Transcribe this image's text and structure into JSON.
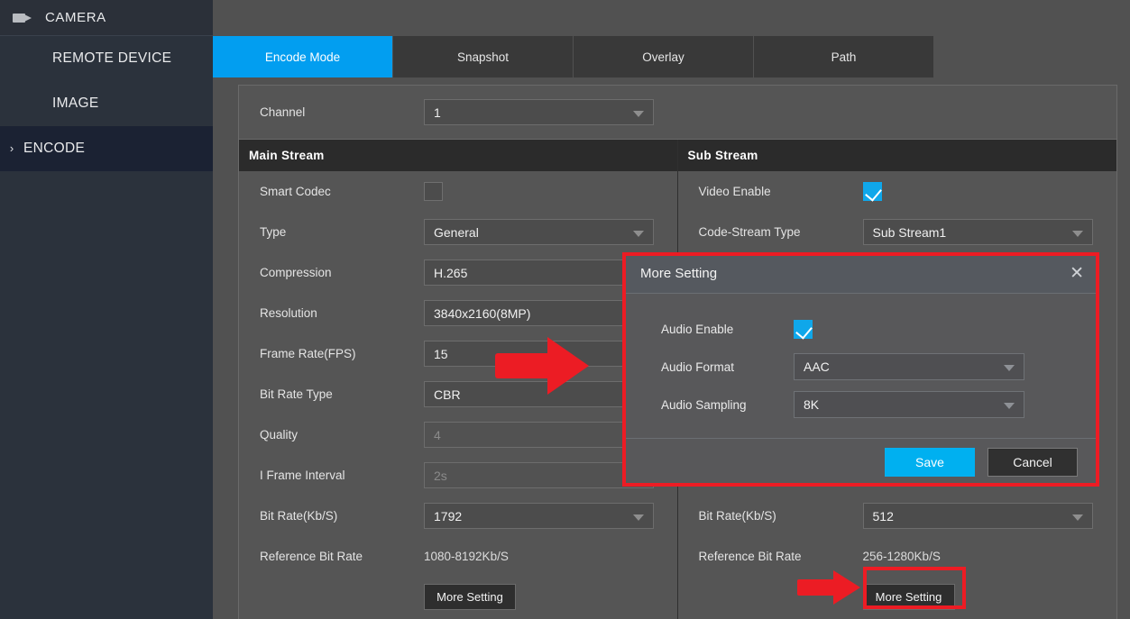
{
  "sidebar": {
    "header": {
      "title": "CAMERA",
      "icon": "video-camera-icon"
    },
    "items": [
      {
        "label": "REMOTE DEVICE",
        "active": false,
        "chevron": ""
      },
      {
        "label": "IMAGE",
        "active": false,
        "chevron": ""
      },
      {
        "label": "ENCODE",
        "active": true,
        "chevron": "›"
      }
    ]
  },
  "tabs": [
    {
      "label": "Encode Mode",
      "active": true
    },
    {
      "label": "Snapshot",
      "active": false
    },
    {
      "label": "Overlay",
      "active": false
    },
    {
      "label": "Path",
      "active": false
    }
  ],
  "channel": {
    "label": "Channel",
    "value": "1"
  },
  "main_stream": {
    "header": "Main Stream",
    "smart_codec_label": "Smart Codec",
    "smart_codec_checked": false,
    "type_label": "Type",
    "type_value": "General",
    "compression_label": "Compression",
    "compression_value": "H.265",
    "resolution_label": "Resolution",
    "resolution_value": "3840x2160(8MP)",
    "frame_rate_label": "Frame Rate(FPS)",
    "frame_rate_value": "15",
    "bit_rate_type_label": "Bit Rate Type",
    "bit_rate_type_value": "CBR",
    "quality_label": "Quality",
    "quality_value": "4",
    "iframe_label": "I Frame Interval",
    "iframe_value": "2s",
    "bit_rate_label": "Bit Rate(Kb/S)",
    "bit_rate_value": "1792",
    "reference_label": "Reference Bit Rate",
    "reference_value": "1080-8192Kb/S",
    "more_setting_label": "More Setting"
  },
  "sub_stream": {
    "header": "Sub Stream",
    "video_enable_label": "Video Enable",
    "video_enable_checked": true,
    "code_stream_label": "Code-Stream Type",
    "code_stream_value": "Sub Stream1",
    "bit_rate_label": "Bit Rate(Kb/S)",
    "bit_rate_value": "512",
    "reference_label": "Reference Bit Rate",
    "reference_value": "256-1280Kb/S",
    "more_setting_label": "More Setting"
  },
  "dialog": {
    "title": "More Setting",
    "close_icon": "✕",
    "audio_enable_label": "Audio Enable",
    "audio_enable_checked": true,
    "audio_format_label": "Audio Format",
    "audio_format_value": "AAC",
    "audio_sampling_label": "Audio Sampling",
    "audio_sampling_value": "8K",
    "save_label": "Save",
    "cancel_label": "Cancel"
  },
  "colors": {
    "accent_blue": "#029ef0",
    "save_blue": "#00b0f0",
    "checkbox_blue": "#0fa7ea",
    "callout_red": "#ec1c24",
    "sidebar_bg": "#2b323c",
    "sidebar_active": "#1b2233",
    "panel_bg": "#555555",
    "page_bg": "#515151"
  }
}
